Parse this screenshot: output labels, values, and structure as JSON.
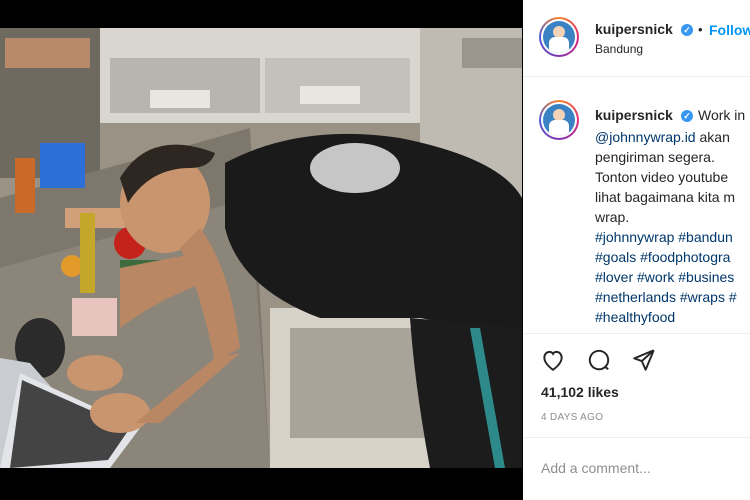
{
  "post": {
    "username": "kuipersnick",
    "follow_label": "Follow",
    "separator": "•",
    "location": "Bandung",
    "caption": {
      "username": "kuipersnick",
      "first_line": "Work in",
      "lines": [
        {
          "mention": "@johnnywrap.id",
          "text": " akan"
        },
        {
          "text": "pengiriman segera."
        },
        {
          "text": "Tonton video youtube"
        },
        {
          "text": "lihat bagaimana kita m"
        },
        {
          "text": "wrap."
        },
        {
          "hashtags": "#johnnywrap #bandun"
        },
        {
          "hashtags": "#goals #foodphotogra"
        },
        {
          "hashtags": "#lover #work #busines"
        },
        {
          "hashtags": "#netherlands #wraps #"
        },
        {
          "hashtags": "#healthyfood"
        }
      ]
    },
    "likes": "41,102 likes",
    "date": "4 DAYS AGO",
    "comment_placeholder": "Add a comment...",
    "icons": {
      "like": "heart-icon",
      "comment": "comment-bubble-icon",
      "share": "paper-plane-icon",
      "verified": "verified-badge-icon"
    },
    "colors": {
      "link_blue": "#0095f6",
      "hashtag": "#00376b",
      "verified": "#3897f0",
      "muted": "#8e8e8e"
    }
  }
}
